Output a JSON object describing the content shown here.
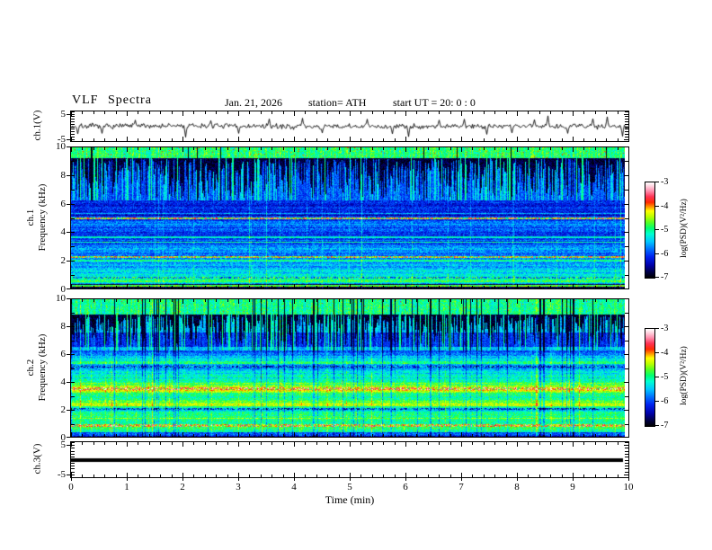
{
  "header": {
    "title": "VLF Spectra",
    "date": "Jan. 21, 2026",
    "station": "station= ATH",
    "start_ut": "start UT =  20: 0 : 0"
  },
  "x_axis": {
    "label": "Time  (min)",
    "range_min": [
      0,
      10
    ],
    "major_ticks": [
      0,
      1,
      2,
      3,
      4,
      5,
      6,
      7,
      8,
      9,
      10
    ],
    "minor_step": 0.2
  },
  "colorbars": [
    {
      "label": "log(PSD)(V²/Hz)",
      "ticks": [
        -3,
        -4,
        -5,
        -6,
        -7
      ],
      "range": [
        -7,
        -3
      ]
    },
    {
      "label": "log(PSD)(V²/Hz)",
      "ticks": [
        -3,
        -4,
        -5,
        -6,
        -7
      ],
      "range": [
        -7,
        -3
      ]
    }
  ],
  "colormap_stops": [
    [
      0.0,
      "#000000"
    ],
    [
      0.05,
      "#00003a"
    ],
    [
      0.13,
      "#0000a8"
    ],
    [
      0.22,
      "#0022f0"
    ],
    [
      0.3,
      "#0070ff"
    ],
    [
      0.38,
      "#00c8ff"
    ],
    [
      0.46,
      "#00ffd0"
    ],
    [
      0.52,
      "#00ff70"
    ],
    [
      0.58,
      "#55ff22"
    ],
    [
      0.64,
      "#baff00"
    ],
    [
      0.7,
      "#ffff00"
    ],
    [
      0.745,
      "#ff9400"
    ],
    [
      0.79,
      "#ff2a00"
    ],
    [
      0.85,
      "#ff3355"
    ],
    [
      0.91,
      "#ff8fae"
    ],
    [
      0.96,
      "#ffd2de"
    ],
    [
      1.0,
      "#ffffff"
    ]
  ],
  "chart_data": [
    {
      "id": "ch1_waveform",
      "type": "line",
      "channel_label": "ch.1(V)",
      "y_ticks": [
        5,
        -5
      ],
      "y_range": [
        -6.25,
        6.25
      ],
      "x_range_min": [
        0,
        10
      ],
      "signal": "broadband noise around 0 V, ~±1.5 V, with impulsive spikes",
      "spikes_min_volts": [
        [
          0.12,
          -3.2
        ],
        [
          0.55,
          -3.0
        ],
        [
          1.15,
          2.6
        ],
        [
          2.05,
          -4.6
        ],
        [
          2.5,
          2.4
        ],
        [
          3.0,
          -3.0
        ],
        [
          3.55,
          3.1
        ],
        [
          4.15,
          3.4
        ],
        [
          4.5,
          -2.8
        ],
        [
          5.3,
          3.0
        ],
        [
          5.75,
          -3.2
        ],
        [
          6.05,
          -4.4
        ],
        [
          6.6,
          2.6
        ],
        [
          7.05,
          3.0
        ],
        [
          7.45,
          -3.4
        ],
        [
          7.9,
          -2.8
        ],
        [
          8.3,
          2.8
        ],
        [
          8.55,
          4.4
        ],
        [
          8.9,
          -3.0
        ],
        [
          9.35,
          3.2
        ],
        [
          9.62,
          4.0
        ],
        [
          9.88,
          -4.2
        ]
      ]
    },
    {
      "id": "ch1_spectrogram",
      "type": "heatmap",
      "channel_label": "ch.1",
      "ylabel": "Frequency  (kHz)",
      "y_ticks": [
        0,
        2,
        4,
        6,
        8,
        10
      ],
      "y_range_khz": [
        0,
        10
      ],
      "z_label": "log(PSD)(V²/Hz)",
      "z_range": [
        -7,
        -3
      ],
      "x_data_end_min": 9.9,
      "profile_khz_level": [
        [
          0.0,
          -6.9
        ],
        [
          0.08,
          -6.9
        ],
        [
          0.12,
          -5.2
        ],
        [
          0.18,
          -6.6
        ],
        [
          0.25,
          -4.8
        ],
        [
          0.32,
          -6.6
        ],
        [
          0.42,
          -5.2
        ],
        [
          0.55,
          -4.9
        ],
        [
          0.75,
          -5.1
        ],
        [
          0.95,
          -5.2
        ],
        [
          1.2,
          -5.5
        ],
        [
          1.6,
          -5.6
        ],
        [
          2.0,
          -5.6
        ],
        [
          2.5,
          -5.8
        ],
        [
          2.9,
          -5.5
        ],
        [
          3.2,
          -6.0
        ],
        [
          3.8,
          -6.1
        ],
        [
          4.3,
          -5.9
        ],
        [
          4.8,
          -5.9
        ],
        [
          5.5,
          -6.1
        ],
        [
          6.3,
          -6.2
        ],
        [
          10.0,
          -6.2
        ]
      ],
      "tone_lines": [
        {
          "khz": 0.15,
          "w": 0.05,
          "lv": -6.9
        },
        {
          "khz": 0.22,
          "w": 0.06,
          "lv": -4.6
        },
        {
          "khz": 0.3,
          "w": 0.05,
          "lv": -6.8
        },
        {
          "khz": 0.5,
          "w": 0.1,
          "lv": -4.8
        },
        {
          "khz": 0.65,
          "w": 0.08,
          "lv": -5.0
        },
        {
          "khz": 0.8,
          "w": 0.14,
          "lv": -5.4,
          "noisy": true
        },
        {
          "khz": 2.0,
          "w": 0.08,
          "lv": -5.0
        },
        {
          "khz": 2.25,
          "w": 0.16,
          "lv": -4.4,
          "noisy": true
        },
        {
          "khz": 3.3,
          "w": 0.1,
          "lv": -5.0
        },
        {
          "khz": 3.65,
          "w": 0.1,
          "lv": -5.2
        },
        {
          "khz": 4.6,
          "w": 0.08,
          "lv": -5.6
        },
        {
          "khz": 5.0,
          "w": 0.15,
          "lv": -4.3,
          "noisy": true
        },
        {
          "khz": 5.2,
          "w": 0.07,
          "lv": -6.5
        }
      ],
      "upper_region": {
        "start_khz": 6.3,
        "top_band_khz": 9.25,
        "top_level": -4.9,
        "icicle_dark_level": -6.8,
        "between_level": -5.9,
        "max_icicle_depth_khz": 2.8,
        "black_line_prob": 0.02,
        "green_streak_prob": 0.055,
        "cyan_col_prob": 0.25,
        "red_speck_prob": 0.012,
        "black_full_height": false
      }
    },
    {
      "id": "ch2_spectrogram",
      "type": "heatmap",
      "channel_label": "ch.2",
      "ylabel": "Frequency  (kHz)",
      "y_ticks": [
        0,
        2,
        4,
        6,
        8,
        10
      ],
      "y_range_khz": [
        0,
        10
      ],
      "z_label": "log(PSD)(V²/Hz)",
      "z_range": [
        -7,
        -3
      ],
      "x_data_end_min": 9.9,
      "profile_khz_level": [
        [
          0.0,
          -7.0
        ],
        [
          0.06,
          -6.9
        ],
        [
          0.1,
          -4.9
        ],
        [
          0.16,
          -6.7
        ],
        [
          0.22,
          -5.2
        ],
        [
          0.3,
          -6.5
        ],
        [
          0.4,
          -5.1
        ],
        [
          0.55,
          -5.0
        ],
        [
          0.7,
          -5.0
        ],
        [
          0.85,
          -4.3
        ],
        [
          1.0,
          -5.1
        ],
        [
          1.4,
          -5.0
        ],
        [
          1.8,
          -5.1
        ],
        [
          2.05,
          -5.7
        ],
        [
          2.2,
          -5.0
        ],
        [
          2.35,
          -4.5
        ],
        [
          2.6,
          -4.8
        ],
        [
          2.9,
          -5.0
        ],
        [
          3.2,
          -4.9
        ],
        [
          3.5,
          -4.1
        ],
        [
          3.8,
          -4.7
        ],
        [
          4.1,
          -5.2
        ],
        [
          4.5,
          -5.3
        ],
        [
          4.9,
          -5.5
        ],
        [
          5.15,
          -5.9
        ],
        [
          5.4,
          -5.0
        ],
        [
          5.7,
          -5.3
        ],
        [
          6.0,
          -5.7
        ],
        [
          6.3,
          -6.1
        ],
        [
          10.0,
          -6.1
        ]
      ],
      "tone_lines": [
        {
          "khz": 0.16,
          "w": 0.05,
          "lv": -6.9
        },
        {
          "khz": 0.3,
          "w": 0.05,
          "lv": -6.8
        },
        {
          "khz": 0.85,
          "w": 0.18,
          "lv": -4.2,
          "noisy": true
        },
        {
          "khz": 2.05,
          "w": 0.14,
          "lv": -5.8,
          "noisy": true
        },
        {
          "khz": 2.35,
          "w": 0.14,
          "lv": -4.4
        },
        {
          "khz": 2.6,
          "w": 0.07,
          "lv": -4.6
        },
        {
          "khz": 3.5,
          "w": 0.2,
          "lv": -4.0,
          "noisy": true
        },
        {
          "khz": 3.95,
          "w": 0.07,
          "lv": -4.6
        },
        {
          "khz": 5.15,
          "w": 0.12,
          "lv": -5.9,
          "noisy": true
        },
        {
          "khz": 5.4,
          "w": 0.12,
          "lv": -4.9
        }
      ],
      "upper_region": {
        "start_khz": 6.3,
        "top_band_khz": 8.9,
        "top_level": -5.0,
        "icicle_dark_level": -6.85,
        "between_level": -5.6,
        "max_icicle_depth_khz": 2.3,
        "black_line_prob": 0.07,
        "green_streak_prob": 0.11,
        "cyan_col_prob": 0.35,
        "red_speck_prob": 0.004,
        "black_full_height": true,
        "dark_band_khz": [
          6.6,
          7.6
        ],
        "dark_band_delta": -0.55
      }
    },
    {
      "id": "ch3_waveform",
      "type": "line",
      "channel_label": "ch.3(V)",
      "y_ticks": [
        5,
        -5
      ],
      "y_range": [
        -6.25,
        6.25
      ],
      "constant_value": 0,
      "x_data_end_min": 9.9,
      "line_thickness_px": 4
    }
  ]
}
